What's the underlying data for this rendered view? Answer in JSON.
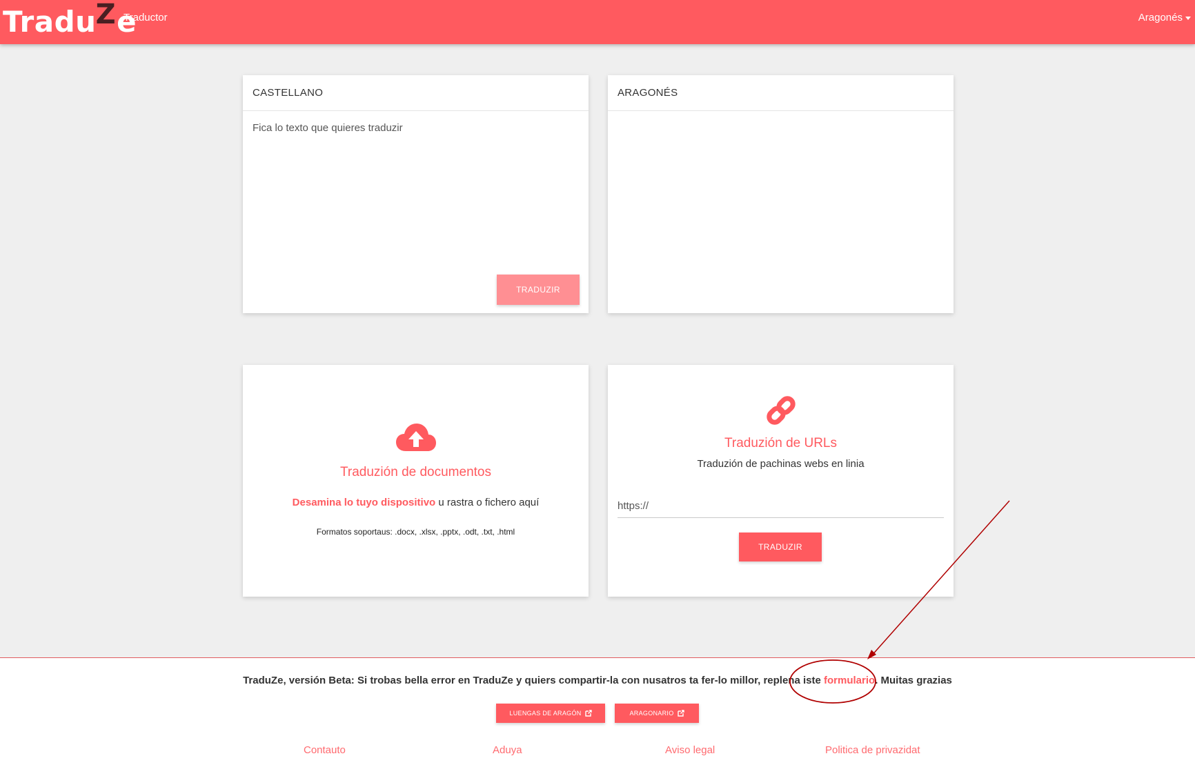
{
  "navbar": {
    "logo": {
      "part1": "Tradu",
      "part2": "Z",
      "part3": "e"
    },
    "nav_link": "Traductor",
    "language_menu": "Aragonés"
  },
  "source_panel": {
    "header": "CASTELLANO",
    "placeholder": "Fica lo texto que quieres traduzir",
    "button": "TRADUZIR"
  },
  "target_panel": {
    "header": "ARAGONÉS"
  },
  "docs_panel": {
    "icon": "cloud-upload-icon",
    "title": "Traduzión de documentos",
    "browse_link": "Desamina lo tuyo dispositivo",
    "drop_text": " u rastra o fichero aquí",
    "formats": "Formatos soportaus: .docx, .xlsx, .pptx, .odt, .txt, .html"
  },
  "urls_panel": {
    "icon": "link-icon",
    "title": "Traduzión de URLs",
    "subtitle": "Traduzión de pachinas webs en linia",
    "url_placeholder": "https://",
    "button": "TRADUZIR"
  },
  "footer": {
    "beta_text": "TraduZe, versión Beta: Si trobas bella error en TraduZe y quiers compartir-la con nusatros ta fer-lo millor, replena iste ",
    "form_link": "formulario",
    "thanks": ". Muitas grazias",
    "buttons": [
      "LUENGAS DE ARAGÓN",
      "ARAGONARIO"
    ],
    "links": [
      "Contauto",
      "Aduya",
      "Aviso legal",
      "Politica de privazidat"
    ]
  },
  "colors": {
    "accent": "#ff5a5f",
    "accent_disabled": "#ff8f93",
    "background": "#efefef",
    "logo_z": "#4a1f22",
    "annotation": "#b00000"
  }
}
